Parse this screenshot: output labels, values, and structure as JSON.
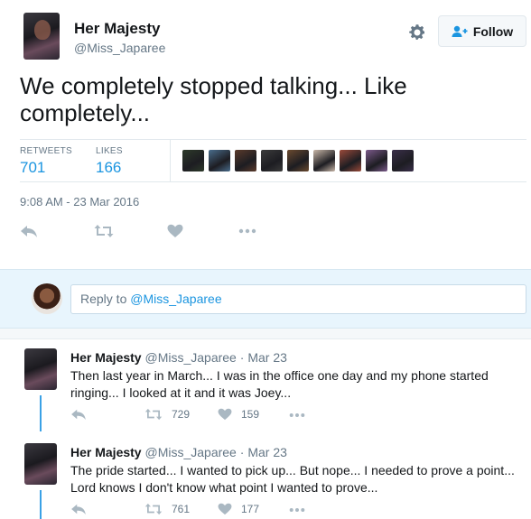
{
  "author": {
    "display_name": "Her Majesty",
    "handle": "@Miss_Japaree"
  },
  "follow_button": {
    "label": "Follow"
  },
  "tweet": {
    "text": "We completely stopped talking... Like completely...",
    "timestamp": "9:08 AM - 23 Mar 2016"
  },
  "stats": {
    "retweets_label": "RETWEETS",
    "retweets_value": "701",
    "likes_label": "LIKES",
    "likes_value": "166"
  },
  "likers": [
    {
      "color": "#2d3a2a"
    },
    {
      "color": "#4a6d8c"
    },
    {
      "color": "#5b3a2b"
    },
    {
      "color": "#3b3b3b"
    },
    {
      "color": "#6b4a2f"
    },
    {
      "color": "#c9b7a8"
    },
    {
      "color": "#9a4a3a"
    },
    {
      "color": "#7b5a8a"
    },
    {
      "color": "#3a2f4a"
    }
  ],
  "reply_box": {
    "prefix": "Reply to ",
    "mention": "@Miss_Japaree"
  },
  "replies": [
    {
      "name": "Her Majesty",
      "handle": "@Miss_Japaree",
      "dot": "·",
      "date": "Mar 23",
      "text": "Then last year in March... I was in the office one day and my phone started ringing... I looked at it and it was Joey...",
      "retweets": "729",
      "likes": "159"
    },
    {
      "name": "Her Majesty",
      "handle": "@Miss_Japaree",
      "dot": "·",
      "date": "Mar 23",
      "text": "The pride started... I wanted to pick up... But nope... I needed to prove a point... Lord knows I don't know what point I wanted to prove...",
      "retweets": "761",
      "likes": "177"
    }
  ],
  "colors": {
    "accent": "#1b95e0",
    "thread_line": "#3aa1e6",
    "muted": "#657786",
    "icon": "#aab8c2",
    "reply_zone": "#e8f5fd"
  }
}
